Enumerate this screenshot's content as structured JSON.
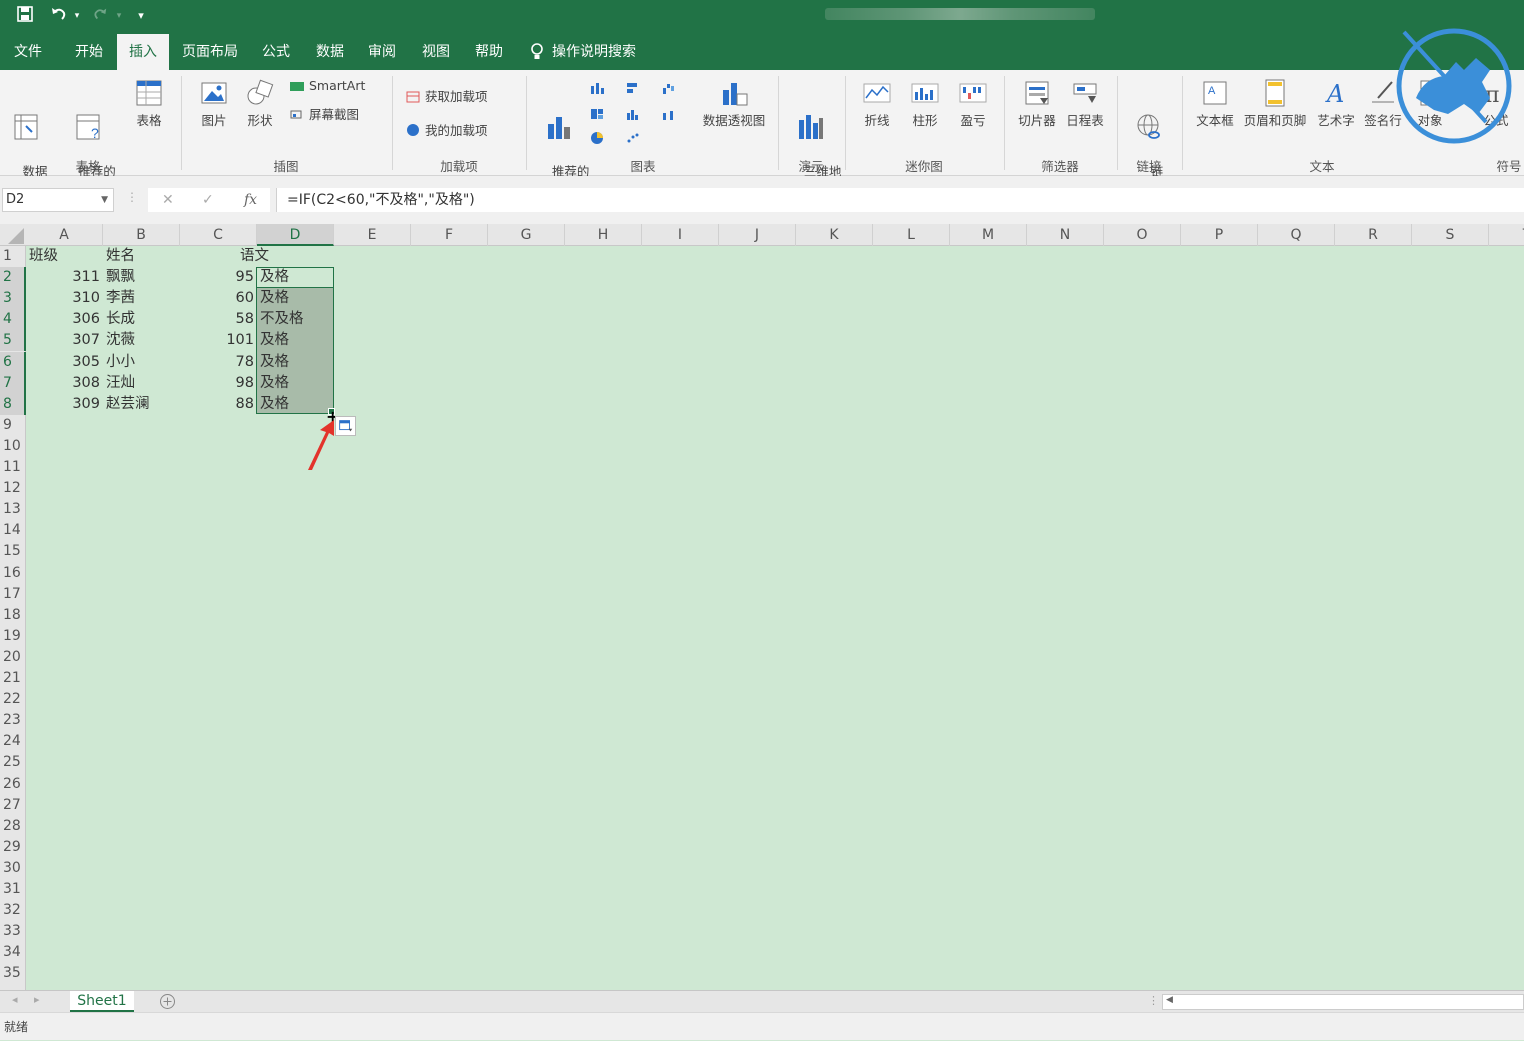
{
  "titlebar": {
    "save_icon": "save-icon",
    "undo_icon": "undo-icon",
    "redo_icon": "redo-icon"
  },
  "tabs": [
    {
      "label": "文件"
    },
    {
      "label": "开始"
    },
    {
      "label": "插入"
    },
    {
      "label": "页面布局"
    },
    {
      "label": "公式"
    },
    {
      "label": "数据"
    },
    {
      "label": "审阅"
    },
    {
      "label": "视图"
    },
    {
      "label": "帮助"
    },
    {
      "label": "操作说明搜索"
    }
  ],
  "active_tab": "插入",
  "ribbon": {
    "pivot": "数据\n透视表",
    "rec_pivot": "推荐的\n数据透视表",
    "table": "表格",
    "picture": "图片",
    "shapes": "形状",
    "smartart": "SmartArt",
    "screenshot": "屏幕截图",
    "get_addins": "获取加载项",
    "my_addins": "我的加载项",
    "rec_charts": "推荐的\n图表",
    "pivot_chart": "数据透视图",
    "map3d": "三维地\n图",
    "line": "折线",
    "column": "柱形",
    "winloss": "盈亏",
    "slicer": "切片器",
    "timeline": "日程表",
    "link": "链\n接",
    "textbox": "文本框",
    "header_footer": "页眉和页脚",
    "wordart": "艺术字",
    "signature": "签名行",
    "object": "对象",
    "formula": "公式",
    "groups": {
      "tables": "表格",
      "illustrations": "插图",
      "addins": "加载项",
      "charts": "图表",
      "tours": "演示",
      "sparklines": "迷你图",
      "filters": "筛选器",
      "links": "链接",
      "text": "文本",
      "symbols": "符号"
    }
  },
  "formula_bar": {
    "name_box": "D2",
    "formula": "=IF(C2<60,\"不及格\",\"及格\")",
    "fx": "fx"
  },
  "columns": [
    "A",
    "B",
    "C",
    "D",
    "E",
    "F",
    "G",
    "H",
    "I",
    "J",
    "K",
    "L",
    "M",
    "N",
    "O",
    "P",
    "Q",
    "R",
    "S",
    "T"
  ],
  "rows": [
    "1",
    "2",
    "3",
    "4",
    "5",
    "6",
    "7",
    "8",
    "9",
    "10",
    "11",
    "12",
    "13",
    "14",
    "15",
    "16",
    "17",
    "18",
    "19",
    "20",
    "21",
    "22",
    "23",
    "24",
    "25",
    "26",
    "27",
    "28",
    "29",
    "30",
    "31",
    "32",
    "33",
    "34",
    "35"
  ],
  "sheet": {
    "headers": {
      "A": "班级",
      "B": "姓名",
      "C": "",
      "D": "语文"
    },
    "data": [
      {
        "class": "311",
        "name": "飘飘",
        "score": "95",
        "result": "及格"
      },
      {
        "class": "310",
        "name": "李茜",
        "score": "60",
        "result": "及格"
      },
      {
        "class": "306",
        "name": "长成",
        "score": "58",
        "result": "不及格"
      },
      {
        "class": "307",
        "name": "沈薇",
        "score": "101",
        "result": "及格"
      },
      {
        "class": "305",
        "name": "小小",
        "score": "78",
        "result": "及格"
      },
      {
        "class": "308",
        "name": "汪灿",
        "score": "98",
        "result": "及格"
      },
      {
        "class": "309",
        "name": "赵芸澜",
        "score": "88",
        "result": "及格"
      }
    ]
  },
  "sheet_tab": "Sheet1",
  "status": "就绪",
  "colors": {
    "excel_green": "#217346",
    "sheet_bg": "#cfe8d3",
    "selection": "#a8bba9"
  }
}
